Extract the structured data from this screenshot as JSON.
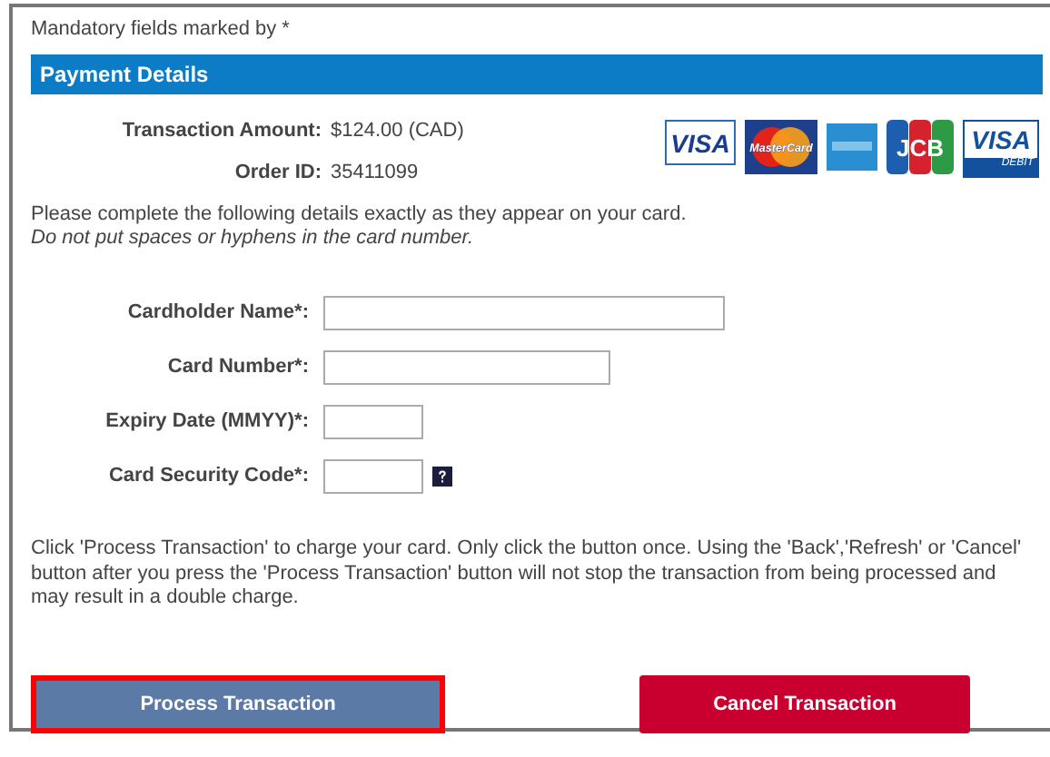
{
  "mandatory_note": "Mandatory fields marked by *",
  "section_title": "Payment Details",
  "summary": [
    {
      "label": "Transaction Amount:",
      "value": "$124.00 (CAD)"
    },
    {
      "label": "Order ID:",
      "value": "35411099"
    }
  ],
  "cards": [
    {
      "kind": "visa",
      "label": "VISA"
    },
    {
      "kind": "mastercard",
      "label": "MasterCard"
    },
    {
      "kind": "amex"
    },
    {
      "kind": "jcb",
      "label": "JCB"
    },
    {
      "kind": "visa-debit",
      "label": "VISA",
      "sublabel": "DEBIT"
    }
  ],
  "instructions": "Please complete the following details exactly as they appear on your card.",
  "instructions_note": "Do not put spaces or hyphens in the card number.",
  "fields": [
    {
      "label": "Cardholder Name*:",
      "kind": "long",
      "help": false
    },
    {
      "label": "Card Number*:",
      "kind": "medium",
      "help": false
    },
    {
      "label": "Expiry Date (MMYY)*:",
      "kind": "short",
      "help": false
    },
    {
      "label": "Card Security Code*:",
      "kind": "short",
      "help": true
    }
  ],
  "warning": "Click 'Process Transaction' to charge your card. Only click the button once. Using the 'Back','Refresh' or 'Cancel' button after you press the 'Process Transaction' button will not stop the transaction from being processed and may result in a double charge.",
  "buttons": [
    {
      "label": "Process Transaction",
      "kind": "primary",
      "highlighted": true
    },
    {
      "label": "Cancel Transaction",
      "kind": "cancel",
      "highlighted": false
    }
  ]
}
